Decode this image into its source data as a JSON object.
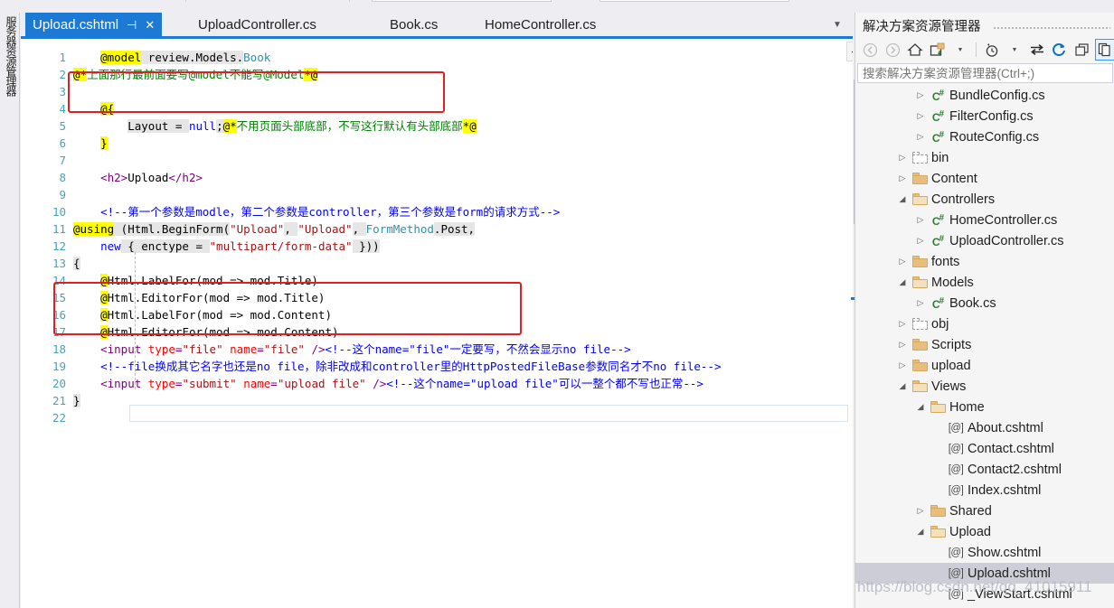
{
  "colors": {
    "accent_blue": "#1C7AD4",
    "annotation_red": "#E02020",
    "tree_selection": "#CDCDD8",
    "chrome_bg": "#EEEEF2",
    "keyword": "#0000FF",
    "string": "#A31515",
    "comment_green": "#008000",
    "type_teal": "#2B91AF",
    "razor_highlight": "#FFFF00"
  },
  "left_rail": {
    "label": "服务器资源管理器"
  },
  "editor": {
    "tabs": [
      {
        "label": "Upload.cshtml",
        "active": true,
        "pin_icon": "pin-icon",
        "close_icon": "close-icon"
      },
      {
        "label": "UploadController.cs",
        "active": false
      },
      {
        "label": "Book.cs",
        "active": false
      },
      {
        "label": "HomeController.cs",
        "active": false
      }
    ],
    "tab_overflow_icon": "chevron-down-icon",
    "split_view_icon": "split-editor-icon",
    "scroll_up_icon": "caret-up-icon",
    "line_numbers": [
      1,
      2,
      3,
      4,
      5,
      6,
      7,
      8,
      9,
      10,
      11,
      12,
      13,
      14,
      15,
      16,
      17,
      18,
      19,
      20,
      21,
      22
    ],
    "lines": [
      {
        "n": 1,
        "tokens": [
          {
            "t": "    ",
            "c": "t-plain"
          },
          {
            "t": "@model",
            "c": "t-raz"
          },
          {
            "t": " review.Models.",
            "c": "t-blk"
          },
          {
            "t": "Book",
            "c": "t-type"
          }
        ]
      },
      {
        "n": 2,
        "tokens": [
          {
            "t": "@*",
            "c": "t-raz"
          },
          {
            "t": "上面那行最前面要写@model不能写@Model",
            "c": "t-cmt"
          },
          {
            "t": "*@",
            "c": "t-raz"
          }
        ]
      },
      {
        "n": 3,
        "tokens": []
      },
      {
        "n": 4,
        "tokens": [
          {
            "t": "    ",
            "c": "t-plain"
          },
          {
            "t": "@{",
            "c": "t-raz"
          }
        ]
      },
      {
        "n": 5,
        "tokens": [
          {
            "t": "        ",
            "c": "t-plain"
          },
          {
            "t": "Layout = ",
            "c": "t-blk"
          },
          {
            "t": "null",
            "c": "t-key"
          },
          {
            "t": ";",
            "c": "t-blk"
          },
          {
            "t": "@*",
            "c": "t-raz"
          },
          {
            "t": "不用页面头部底部，不写这行默认有头部底部",
            "c": "t-cmt"
          },
          {
            "t": "*@",
            "c": "t-raz"
          }
        ]
      },
      {
        "n": 6,
        "tokens": [
          {
            "t": "    ",
            "c": "t-plain"
          },
          {
            "t": "}",
            "c": "t-raz"
          }
        ]
      },
      {
        "n": 7,
        "tokens": []
      },
      {
        "n": 8,
        "tokens": [
          {
            "t": "    ",
            "c": "t-plain"
          },
          {
            "t": "<h2>",
            "c": "t-tag"
          },
          {
            "t": "Upload",
            "c": "t-plain"
          },
          {
            "t": "</h2>",
            "c": "t-tag"
          }
        ]
      },
      {
        "n": 9,
        "tokens": []
      },
      {
        "n": 10,
        "tokens": [
          {
            "t": "    ",
            "c": "t-plain"
          },
          {
            "t": "<!--第一个参数是modle，第二个参数是controller，第三个参数是form的请求方式-->",
            "c": "t-cmt-blue"
          }
        ]
      },
      {
        "n": 11,
        "tokens": [
          {
            "t": "@using",
            "c": "t-raz"
          },
          {
            "t": " (Html.BeginForm(",
            "c": "t-blk"
          },
          {
            "t": "\"Upload\"",
            "c": "t-str"
          },
          {
            "t": ", ",
            "c": "t-blk"
          },
          {
            "t": "\"Upload\"",
            "c": "t-str"
          },
          {
            "t": ", ",
            "c": "t-blk"
          },
          {
            "t": "FormMethod",
            "c": "t-type"
          },
          {
            "t": ".Post,",
            "c": "t-blk"
          }
        ]
      },
      {
        "n": 12,
        "tokens": [
          {
            "t": "    ",
            "c": "t-plain"
          },
          {
            "t": "new",
            "c": "t-key"
          },
          {
            "t": " { enctype = ",
            "c": "t-blk"
          },
          {
            "t": "\"multipart/form-data\"",
            "c": "t-str"
          },
          {
            "t": " }))",
            "c": "t-blk"
          }
        ]
      },
      {
        "n": 13,
        "tokens": [
          {
            "t": "{",
            "c": "t-blk"
          }
        ]
      },
      {
        "n": 14,
        "tokens": [
          {
            "t": "    ",
            "c": "t-plain"
          },
          {
            "t": "@",
            "c": "t-raz"
          },
          {
            "t": "Html.LabelFor(mod => mod.Title)",
            "c": "t-plain"
          }
        ]
      },
      {
        "n": 15,
        "tokens": [
          {
            "t": "    ",
            "c": "t-plain"
          },
          {
            "t": "@",
            "c": "t-raz"
          },
          {
            "t": "Html.EditorFor(mod => mod.Title)",
            "c": "t-plain"
          }
        ]
      },
      {
        "n": 16,
        "tokens": [
          {
            "t": "    ",
            "c": "t-plain"
          },
          {
            "t": "@",
            "c": "t-raz"
          },
          {
            "t": "Html.LabelFor(mod => mod.Content)",
            "c": "t-plain"
          }
        ]
      },
      {
        "n": 17,
        "tokens": [
          {
            "t": "    ",
            "c": "t-plain"
          },
          {
            "t": "@",
            "c": "t-raz"
          },
          {
            "t": "Html.EditorFor(mod => mod.Content)",
            "c": "t-plain"
          }
        ]
      },
      {
        "n": 18,
        "tokens": [
          {
            "t": "    ",
            "c": "t-plain"
          },
          {
            "t": "<input ",
            "c": "t-tag"
          },
          {
            "t": "type",
            "c": "t-attr"
          },
          {
            "t": "=",
            "c": "t-tag"
          },
          {
            "t": "\"file\"",
            "c": "t-str"
          },
          {
            "t": " ",
            "c": "t-tag"
          },
          {
            "t": "name",
            "c": "t-attr"
          },
          {
            "t": "=",
            "c": "t-tag"
          },
          {
            "t": "\"file\"",
            "c": "t-str"
          },
          {
            "t": " />",
            "c": "t-tag"
          },
          {
            "t": "<!--这个name=\"file\"一定要写，不然会显示no file-->",
            "c": "t-cmt-blue"
          }
        ]
      },
      {
        "n": 19,
        "tokens": [
          {
            "t": "    ",
            "c": "t-plain"
          },
          {
            "t": "<!--file换成其它名字也还是no file，除非改成和controller里的HttpPostedFileBase参数同名才不no file-->",
            "c": "t-cmt-blue"
          }
        ]
      },
      {
        "n": 20,
        "tokens": [
          {
            "t": "    ",
            "c": "t-plain"
          },
          {
            "t": "<input ",
            "c": "t-tag"
          },
          {
            "t": "type",
            "c": "t-attr"
          },
          {
            "t": "=",
            "c": "t-tag"
          },
          {
            "t": "\"submit\"",
            "c": "t-str"
          },
          {
            "t": " ",
            "c": "t-tag"
          },
          {
            "t": "name",
            "c": "t-attr"
          },
          {
            "t": "=",
            "c": "t-tag"
          },
          {
            "t": "\"upload file\"",
            "c": "t-str"
          },
          {
            "t": " />",
            "c": "t-tag"
          },
          {
            "t": "<!--这个name=\"upload file\"可以一整个都不写也正常-->",
            "c": "t-cmt-blue"
          }
        ]
      },
      {
        "n": 21,
        "tokens": [
          {
            "t": "}",
            "c": "t-blk"
          }
        ]
      },
      {
        "n": 22,
        "tokens": []
      }
    ],
    "annotations": [
      {
        "name": "annotation-rect-model-lines",
        "covers": "lines 1-2"
      },
      {
        "name": "annotation-rect-helper-lines",
        "covers": "lines 14-17"
      }
    ]
  },
  "solution_explorer": {
    "title": "解决方案资源管理器",
    "search": {
      "placeholder": "搜索解决方案资源管理器(Ctrl+;)",
      "value": ""
    },
    "toolbar": [
      {
        "name": "back-button",
        "icon": "left-arrow-icon",
        "label": "◀"
      },
      {
        "name": "forward-button",
        "icon": "right-arrow-icon",
        "label": "▶"
      },
      {
        "name": "home-button",
        "icon": "home-icon",
        "label": "⌂"
      },
      {
        "name": "new-folder-button",
        "icon": "new-folder-icon",
        "label": "▣"
      },
      {
        "name": "new-folder-dropdown",
        "icon": "chevron-down-icon",
        "label": "▾"
      },
      {
        "name": "pending-changes-button",
        "icon": "clock-icon",
        "label": "◷"
      },
      {
        "name": "pending-changes-dropdown",
        "icon": "chevron-down-icon",
        "label": "▾"
      },
      {
        "name": "sync-button",
        "icon": "sync-arrows-icon",
        "label": "⇄"
      },
      {
        "name": "refresh-button",
        "icon": "refresh-icon",
        "label": "↻"
      },
      {
        "name": "collapse-all-button",
        "icon": "collapse-all-icon",
        "label": "❐"
      },
      {
        "name": "show-all-files-button",
        "icon": "show-all-files-icon",
        "label": "▤"
      }
    ],
    "tree": [
      {
        "label": "BundleConfig.cs",
        "indent": 3,
        "expander": "collapsed",
        "icon": "csharp-file-icon"
      },
      {
        "label": "FilterConfig.cs",
        "indent": 3,
        "expander": "collapsed",
        "icon": "csharp-file-icon"
      },
      {
        "label": "RouteConfig.cs",
        "indent": 3,
        "expander": "collapsed",
        "icon": "csharp-file-icon"
      },
      {
        "label": "bin",
        "indent": 2,
        "expander": "collapsed",
        "icon": "folder-dashed-icon"
      },
      {
        "label": "Content",
        "indent": 2,
        "expander": "collapsed",
        "icon": "folder-closed-icon"
      },
      {
        "label": "Controllers",
        "indent": 2,
        "expander": "expanded",
        "icon": "folder-open-icon"
      },
      {
        "label": "HomeController.cs",
        "indent": 3,
        "expander": "collapsed",
        "icon": "csharp-file-icon"
      },
      {
        "label": "UploadController.cs",
        "indent": 3,
        "expander": "collapsed",
        "icon": "csharp-file-icon"
      },
      {
        "label": "fonts",
        "indent": 2,
        "expander": "collapsed",
        "icon": "folder-closed-icon"
      },
      {
        "label": "Models",
        "indent": 2,
        "expander": "expanded",
        "icon": "folder-open-icon"
      },
      {
        "label": "Book.cs",
        "indent": 3,
        "expander": "collapsed",
        "icon": "csharp-file-icon"
      },
      {
        "label": "obj",
        "indent": 2,
        "expander": "collapsed",
        "icon": "folder-dashed-icon"
      },
      {
        "label": "Scripts",
        "indent": 2,
        "expander": "collapsed",
        "icon": "folder-closed-icon"
      },
      {
        "label": "upload",
        "indent": 2,
        "expander": "collapsed",
        "icon": "folder-closed-icon"
      },
      {
        "label": "Views",
        "indent": 2,
        "expander": "expanded",
        "icon": "folder-open-icon"
      },
      {
        "label": "Home",
        "indent": 3,
        "expander": "expanded",
        "icon": "folder-open-icon"
      },
      {
        "label": "About.cshtml",
        "indent": 4,
        "expander": "none",
        "icon": "razor-file-icon"
      },
      {
        "label": "Contact.cshtml",
        "indent": 4,
        "expander": "none",
        "icon": "razor-file-icon"
      },
      {
        "label": "Contact2.cshtml",
        "indent": 4,
        "expander": "none",
        "icon": "razor-file-icon"
      },
      {
        "label": "Index.cshtml",
        "indent": 4,
        "expander": "none",
        "icon": "razor-file-icon"
      },
      {
        "label": "Shared",
        "indent": 3,
        "expander": "collapsed",
        "icon": "folder-closed-icon"
      },
      {
        "label": "Upload",
        "indent": 3,
        "expander": "expanded",
        "icon": "folder-open-icon"
      },
      {
        "label": "Show.cshtml",
        "indent": 4,
        "expander": "none",
        "icon": "razor-file-icon"
      },
      {
        "label": "Upload.cshtml",
        "indent": 4,
        "expander": "none",
        "icon": "razor-file-icon",
        "selected": true
      },
      {
        "label": "_ViewStart.cshtml",
        "indent": 4,
        "expander": "none",
        "icon": "razor-file-icon"
      }
    ]
  },
  "watermark": {
    "text": "https://blog.csdn.net/qq_41015911"
  }
}
